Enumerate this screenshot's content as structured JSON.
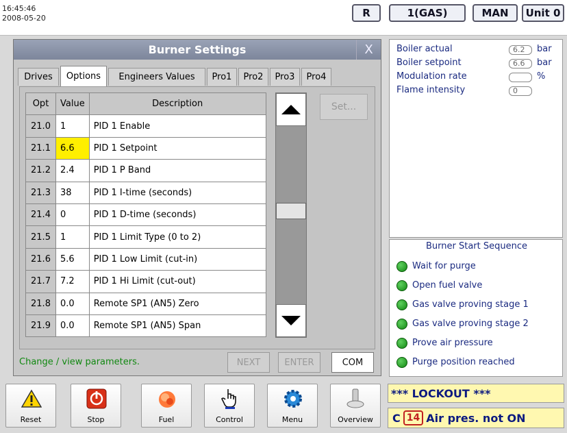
{
  "header": {
    "time": "16:45:46",
    "date": "2008-05-20",
    "mode_r": "R",
    "fuel": "1(GAS)",
    "control_mode": "MAN",
    "unit": "Unit 0"
  },
  "dialog": {
    "title": "Burner Settings",
    "close": "X",
    "tabs": [
      "Drives",
      "Options",
      "Engineers Values",
      "Pro1",
      "Pro2",
      "Pro3",
      "Pro4"
    ],
    "active_tab": "Options",
    "columns": [
      "Opt",
      "Value",
      "Description"
    ],
    "rows": [
      {
        "opt": "21.0",
        "value": "1",
        "desc": "PID 1 Enable"
      },
      {
        "opt": "21.1",
        "value": "6.6",
        "desc": "PID 1 Setpoint"
      },
      {
        "opt": "21.2",
        "value": "2.4",
        "desc": "PID 1 P Band"
      },
      {
        "opt": "21.3",
        "value": "38",
        "desc": "PID 1 I-time (seconds)"
      },
      {
        "opt": "21.4",
        "value": "0",
        "desc": "PID 1 D-time (seconds)"
      },
      {
        "opt": "21.5",
        "value": "1",
        "desc": "PID 1 Limit Type (0 to 2)"
      },
      {
        "opt": "21.6",
        "value": "5.6",
        "desc": "PID 1 Low Limit (cut-in)"
      },
      {
        "opt": "21.7",
        "value": "7.2",
        "desc": "PID 1 Hi Limit (cut-out)"
      },
      {
        "opt": "21.8",
        "value": "0.0",
        "desc": "Remote SP1 (AN5) Zero"
      },
      {
        "opt": "21.9",
        "value": "0.0",
        "desc": "Remote SP1 (AN5) Span"
      }
    ],
    "set_button": "Set...",
    "status": "Change / view parameters.",
    "next": "NEXT",
    "enter": "ENTER",
    "com": "COM"
  },
  "readings": [
    {
      "label": "Boiler actual",
      "value": "6.2",
      "unit": "bar"
    },
    {
      "label": "Boiler setpoint",
      "value": "6.6",
      "unit": "bar"
    },
    {
      "label": "Modulation rate",
      "value": "",
      "unit": "%"
    },
    {
      "label": "Flame intensity",
      "value": "0",
      "unit": ""
    }
  ],
  "sequence": {
    "title": "Burner Start Sequence",
    "steps": [
      "Wait for purge",
      "Open fuel valve",
      "Gas valve proving stage 1",
      "Gas valve proving stage 2",
      "Prove air pressure",
      "Purge position reached"
    ]
  },
  "toolbar": [
    "Reset",
    "Stop",
    "Fuel",
    "Control",
    "Menu",
    "Overview"
  ],
  "alarm": {
    "lockout": "*** LOCKOUT ***",
    "prefix": "C",
    "code": "14",
    "message": "Air pres. not ON"
  },
  "colors": {
    "highlight": "#ffef00",
    "status_ok": "#138813",
    "title_bar": "#8a93a8"
  }
}
